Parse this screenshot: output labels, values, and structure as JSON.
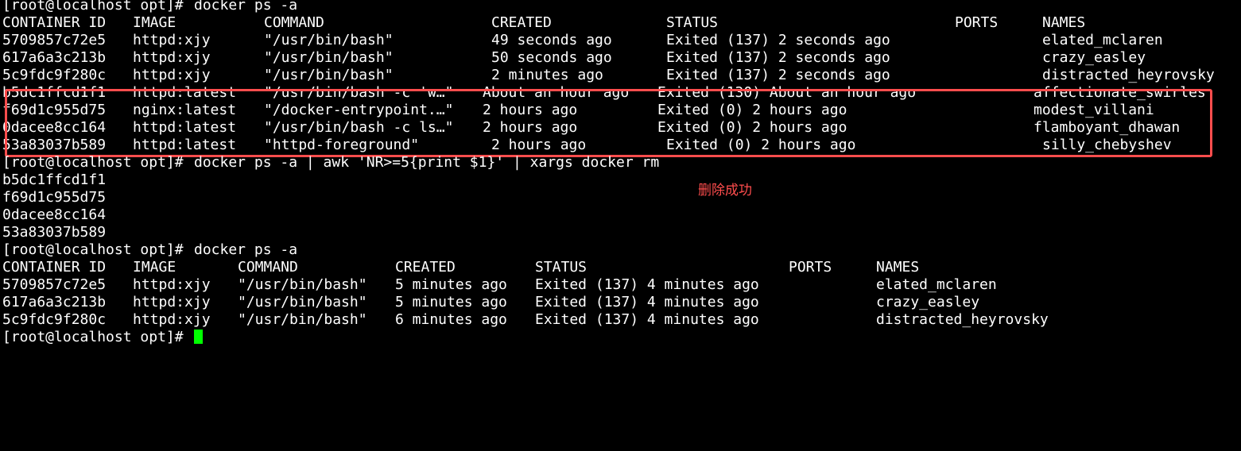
{
  "terminal": {
    "cursor_color": "#00ff00",
    "text_color": "#ffffff",
    "background_color": "#000000",
    "prompt": "[root@localhost opt]#",
    "commands": {
      "ps_first": "docker ps -a",
      "remove": "docker ps -a | awk 'NR>=5{print $1}' | xargs docker rm",
      "ps_second": "docker ps -a"
    },
    "first_listing": {
      "headers": {
        "container_id": "CONTAINER ID",
        "image": "IMAGE",
        "command": "COMMAND",
        "created": "CREATED",
        "status": "STATUS",
        "ports": "PORTS",
        "names": "NAMES"
      },
      "rows": [
        {
          "container_id": "5709857c72e5",
          "image": "httpd:xjy",
          "command": "\"/usr/bin/bash\"",
          "created": "49 seconds ago",
          "status": "Exited (137) 2 seconds ago",
          "names": "elated_mclaren"
        },
        {
          "container_id": "617a6a3c213b",
          "image": "httpd:xjy",
          "command": "\"/usr/bin/bash\"",
          "created": "50 seconds ago",
          "status": "Exited (137) 2 seconds ago",
          "names": "crazy_easley"
        },
        {
          "container_id": "5c9fdc9f280c",
          "image": "httpd:xjy",
          "command": "\"/usr/bin/bash\"",
          "created": "2 minutes ago",
          "status": "Exited (137) 2 seconds ago",
          "names": "distracted_heyrovsky"
        },
        {
          "container_id": "b5dc1ffcd1f1",
          "image": "httpd:latest",
          "command": "\"/usr/bin/bash -c 'w…\"",
          "created": "About an hour ago",
          "status": "Exited (130) About an hour ago",
          "names": "affectionate_swirles"
        },
        {
          "container_id": "f69d1c955d75",
          "image": "nginx:latest",
          "command": "\"/docker-entrypoint.…\"",
          "created": "2 hours ago",
          "status": "Exited (0) 2 hours ago",
          "names": "modest_villani"
        },
        {
          "container_id": "0dacee8cc164",
          "image": "httpd:latest",
          "command": "\"/usr/bin/bash -c ls…\"",
          "created": "2 hours ago",
          "status": "Exited (0) 2 hours ago",
          "names": "flamboyant_dhawan"
        },
        {
          "container_id": "53a83037b589",
          "image": "httpd:latest",
          "command": "\"httpd-foreground\"",
          "created": "2 hours ago",
          "status": "Exited (0) 2 hours ago",
          "names": "silly_chebyshev"
        }
      ]
    },
    "removed_ids": [
      "b5dc1ffcd1f1",
      "f69d1c955d75",
      "0dacee8cc164",
      "53a83037b589"
    ],
    "annotation_text": "删除成功",
    "annotation_color": "#ff4d4d",
    "second_listing": {
      "headers": {
        "container_id": "CONTAINER ID",
        "image": "IMAGE",
        "command": "COMMAND",
        "created": "CREATED",
        "status": "STATUS",
        "ports": "PORTS",
        "names": "NAMES"
      },
      "rows": [
        {
          "container_id": "5709857c72e5",
          "image": "httpd:xjy",
          "command": "\"/usr/bin/bash\"",
          "created": "5 minutes ago",
          "status": "Exited (137) 4 minutes ago",
          "names": "elated_mclaren"
        },
        {
          "container_id": "617a6a3c213b",
          "image": "httpd:xjy",
          "command": "\"/usr/bin/bash\"",
          "created": "5 minutes ago",
          "status": "Exited (137) 4 minutes ago",
          "names": "crazy_easley"
        },
        {
          "container_id": "5c9fdc9f280c",
          "image": "httpd:xjy",
          "command": "\"/usr/bin/bash\"",
          "created": "6 minutes ago",
          "status": "Exited (137) 4 minutes ago",
          "names": "distracted_heyrovsky"
        }
      ]
    }
  }
}
